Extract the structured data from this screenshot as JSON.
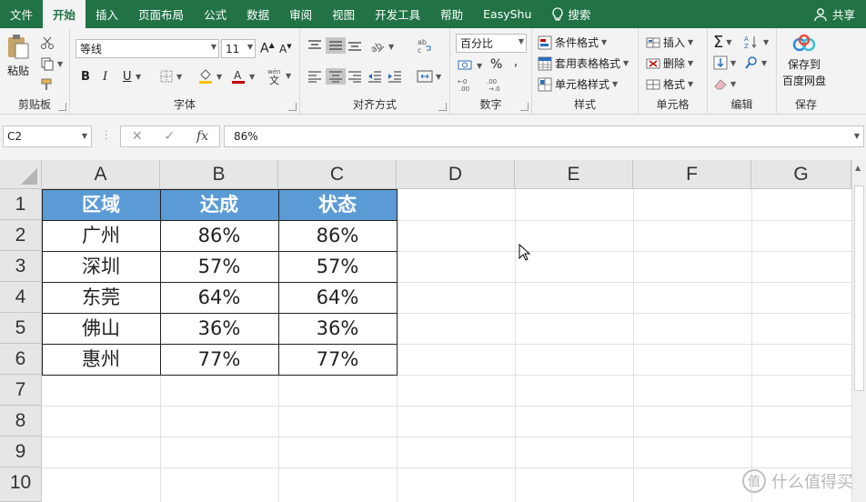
{
  "menu": {
    "tabs": [
      "文件",
      "开始",
      "插入",
      "页面布局",
      "公式",
      "数据",
      "审阅",
      "视图",
      "开发工具",
      "帮助",
      "EasyShu"
    ],
    "active_tab": "开始",
    "search_label": "搜索",
    "share_label": "共享"
  },
  "ribbon": {
    "clipboard": {
      "paste_label": "粘贴",
      "group_label": "剪贴板"
    },
    "font": {
      "font_name": "等线",
      "font_size": "11",
      "group_label": "字体",
      "bold": "B",
      "italic": "I",
      "underline": "U"
    },
    "alignment": {
      "group_label": "对齐方式"
    },
    "number": {
      "format": "百分比",
      "group_label": "数字",
      "percent": "%"
    },
    "styles": {
      "conditional": "条件格式",
      "table_format": "套用表格格式",
      "cell_styles": "单元格样式",
      "group_label": "样式"
    },
    "cells": {
      "insert": "插入",
      "delete": "删除",
      "format": "格式",
      "group_label": "单元格"
    },
    "editing": {
      "group_label": "编辑"
    },
    "save": {
      "label_line1": "保存到",
      "label_line2": "百度网盘",
      "group_label": "保存"
    }
  },
  "formula_bar": {
    "name_box": "C2",
    "cancel": "✕",
    "enter": "✓",
    "fx": "fx",
    "value": "86%"
  },
  "sheet": {
    "columns": [
      "A",
      "B",
      "C",
      "D",
      "E",
      "F",
      "G"
    ],
    "rows": [
      "1",
      "2",
      "3",
      "4",
      "5",
      "6",
      "7",
      "8",
      "9",
      "10"
    ],
    "table": {
      "headers": [
        "区域",
        "达成",
        "状态"
      ],
      "rows": [
        [
          "广州",
          "86%",
          "86%"
        ],
        [
          "深圳",
          "57%",
          "57%"
        ],
        [
          "东莞",
          "64%",
          "64%"
        ],
        [
          "佛山",
          "36%",
          "36%"
        ],
        [
          "惠州",
          "77%",
          "77%"
        ]
      ]
    }
  },
  "watermark": {
    "text": "什么值得买",
    "glyph": "值"
  },
  "colors": {
    "excel_green": "#217346",
    "header_fill": "#5b9bd5"
  }
}
